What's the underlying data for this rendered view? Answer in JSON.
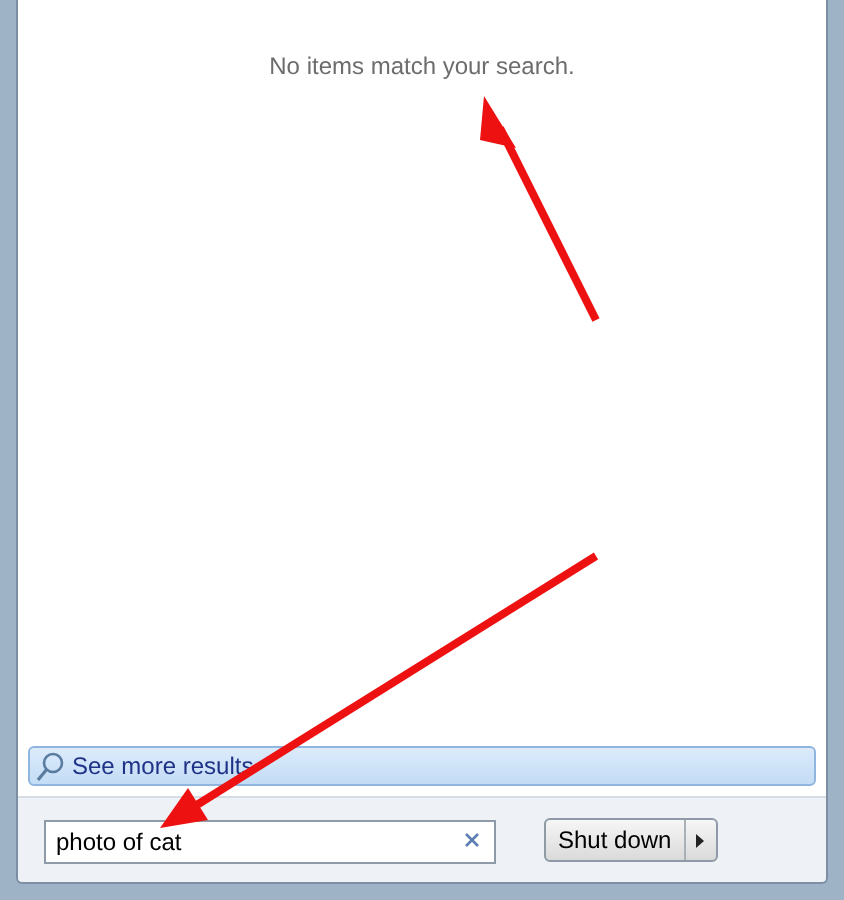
{
  "results": {
    "message": "No items match your search."
  },
  "see_more": {
    "label": "See more results"
  },
  "search": {
    "value": "photo of cat"
  },
  "power": {
    "label": "Shut down"
  }
}
